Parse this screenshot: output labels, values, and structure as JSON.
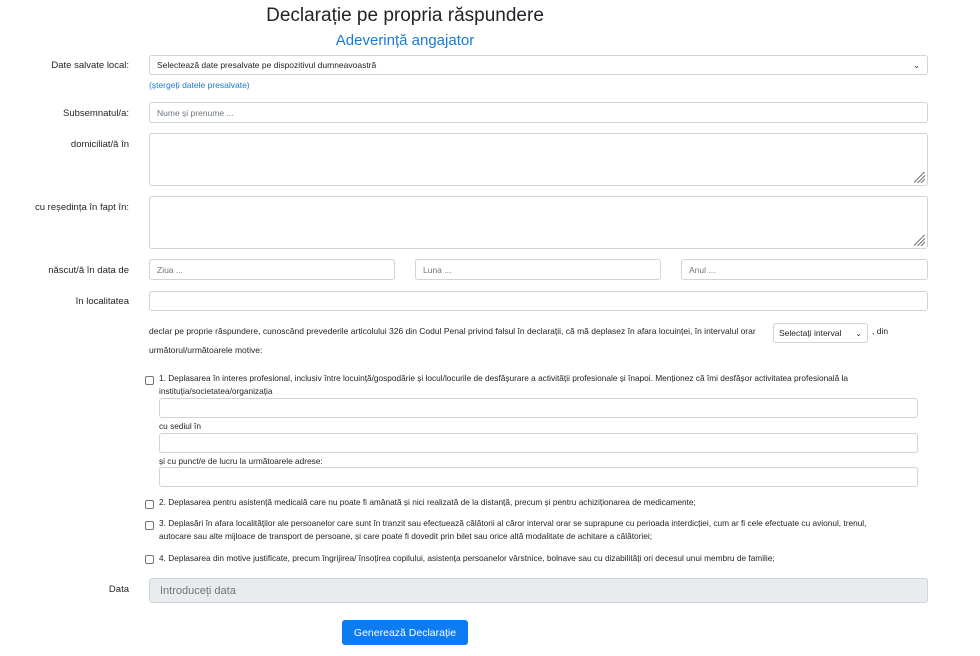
{
  "header": {
    "title": "Declarație pe propria răspundere",
    "subtitle": "Adeverință angajator"
  },
  "form": {
    "saved_label": "Date salvate local:",
    "saved_select_value": "Selectează date presalvate pe dispozitivul dumneavoastră",
    "delete_link": "(ștergeți datele presalvate)",
    "name_label": "Subsemnatul/a:",
    "name_placeholder": "Nume și prenume ...",
    "domicile_label": "domiciliat/ă în",
    "residence_label": "cu reședința în fapt în:",
    "born_label": "născut/ă în data de",
    "day_placeholder": "Ziua ...",
    "month_placeholder": "Luna ...",
    "year_placeholder": "Anul ...",
    "locality_label": "în localitatea",
    "declaration_text_before": "declar pe proprie răspundere, cunoscând prevederile articolului 326 din Codul Penal privind falsul în declarații, că mă deplasez în afara locuinței, în intervalul orar",
    "interval_select": "Selectați interval",
    "declaration_text_after": ", din",
    "declaration_text_line2": "următorul/următoarele motive:",
    "reason1_line1": "1. Deplasarea în interes profesional, inclusiv între locuință/gospodărie și locul/locurile de desfășurare a activității profesionale și înapoi. Menționez că îmi desfășor activitatea profesională la",
    "reason1_line2": "instituția/societatea/organizația",
    "seat_label": "cu sediul în",
    "workplaces_label": "și cu punct/e de lucru la următoarele adrese:",
    "reason2": "2. Deplasarea pentru asistență medicală care nu poate fi amânată și nici realizată de la distanță, precum și pentru achiziționarea de medicamente;",
    "reason3_line1": "3. Deplasări în afara localităților ale persoanelor care sunt în tranzit sau efectuează călătorii al căror interval orar se suprapune cu perioada interdicției, cum ar fi cele efectuate cu avionul, trenul,",
    "reason3_line2": "autocare sau alte mijloace de transport de persoane, și care poate fi dovedit prin bilet sau orice altă modalitate de achitare a călătoriei;",
    "reason4": "4. Deplasarea din motive justificate, precum îngrijirea/ însoțirea copilului, asistența persoanelor vârstnice, bolnave sau cu dizabilități ori decesul unui membru de familie;",
    "date_label": "Data",
    "date_placeholder": "Introduceți data",
    "submit_label": "Generează Declarație"
  },
  "icons": {
    "select_chevron": "chevron-down-icon",
    "resize_grip": "resize-grip-icon"
  },
  "colors": {
    "accent": "#1a7ad4",
    "button": "#0d7bf2",
    "border": "#ced4da",
    "disabled_bg": "#e9ecef"
  }
}
